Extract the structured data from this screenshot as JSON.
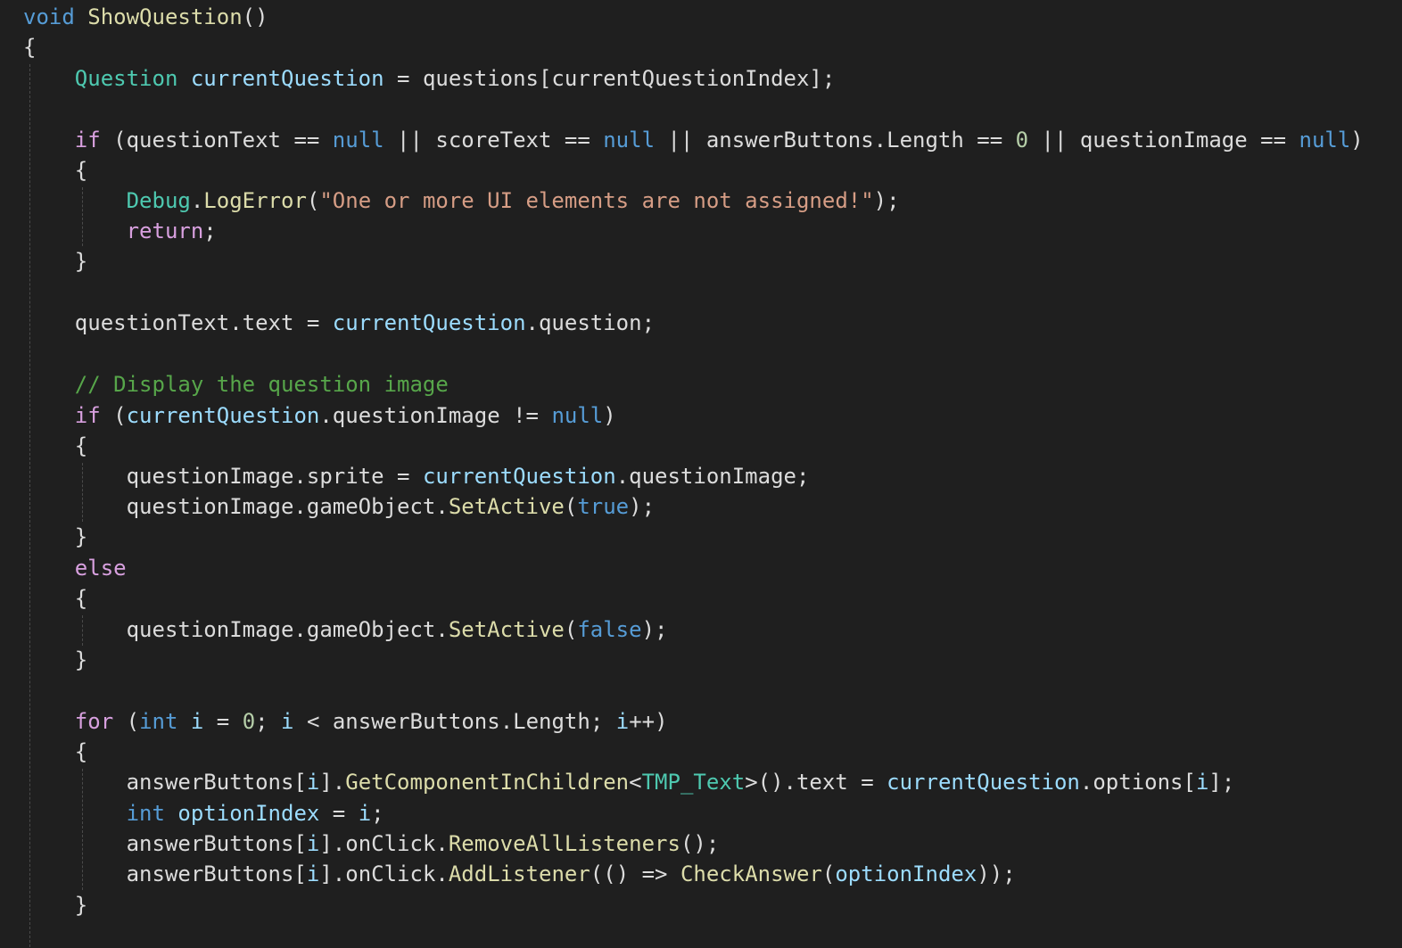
{
  "editor": {
    "language": "C#",
    "theme_colors": {
      "background": "#1f1f1f",
      "default": "#dcdcdc",
      "keyword": "#569cd6",
      "control": "#d8a0df",
      "type": "#4ec9b0",
      "method": "#dcdcaa",
      "local": "#9cdcfe",
      "string": "#d69d85",
      "number": "#b5cea8",
      "comment": "#57a64a",
      "guide": "#4a4a4a"
    },
    "lines": [
      [
        [
          "kw",
          "void"
        ],
        [
          "txt",
          " "
        ],
        [
          "fn",
          "ShowQuestion"
        ],
        [
          "txt",
          "()"
        ]
      ],
      [
        [
          "txt",
          "{"
        ]
      ],
      [
        [
          "txt",
          "    "
        ],
        [
          "type",
          "Question"
        ],
        [
          "txt",
          " "
        ],
        [
          "var",
          "currentQuestion"
        ],
        [
          "txt",
          " = questions[currentQuestionIndex];"
        ]
      ],
      [],
      [
        [
          "txt",
          "    "
        ],
        [
          "ctl",
          "if"
        ],
        [
          "txt",
          " (questionText == "
        ],
        [
          "kw",
          "null"
        ],
        [
          "txt",
          " || scoreText == "
        ],
        [
          "kw",
          "null"
        ],
        [
          "txt",
          " || answerButtons.Length == "
        ],
        [
          "num",
          "0"
        ],
        [
          "txt",
          " || questionImage == "
        ],
        [
          "kw",
          "null"
        ],
        [
          "txt",
          ")"
        ]
      ],
      [
        [
          "txt",
          "    {"
        ]
      ],
      [
        [
          "txt",
          "        "
        ],
        [
          "type",
          "Debug"
        ],
        [
          "txt",
          "."
        ],
        [
          "fn",
          "LogError"
        ],
        [
          "txt",
          "("
        ],
        [
          "str",
          "\"One or more UI elements are not assigned!\""
        ],
        [
          "txt",
          ");"
        ]
      ],
      [
        [
          "txt",
          "        "
        ],
        [
          "ctl",
          "return"
        ],
        [
          "txt",
          ";"
        ]
      ],
      [
        [
          "txt",
          "    }"
        ]
      ],
      [],
      [
        [
          "txt",
          "    questionText.text = "
        ],
        [
          "var",
          "currentQuestion"
        ],
        [
          "txt",
          ".question;"
        ]
      ],
      [],
      [
        [
          "txt",
          "    "
        ],
        [
          "cmt",
          "// Display the question image"
        ]
      ],
      [
        [
          "txt",
          "    "
        ],
        [
          "ctl",
          "if"
        ],
        [
          "txt",
          " ("
        ],
        [
          "var",
          "currentQuestion"
        ],
        [
          "txt",
          ".questionImage != "
        ],
        [
          "kw",
          "null"
        ],
        [
          "txt",
          ")"
        ]
      ],
      [
        [
          "txt",
          "    {"
        ]
      ],
      [
        [
          "txt",
          "        questionImage.sprite = "
        ],
        [
          "var",
          "currentQuestion"
        ],
        [
          "txt",
          ".questionImage;"
        ]
      ],
      [
        [
          "txt",
          "        questionImage.gameObject."
        ],
        [
          "fn",
          "SetActive"
        ],
        [
          "txt",
          "("
        ],
        [
          "kw",
          "true"
        ],
        [
          "txt",
          ");"
        ]
      ],
      [
        [
          "txt",
          "    }"
        ]
      ],
      [
        [
          "txt",
          "    "
        ],
        [
          "ctl",
          "else"
        ]
      ],
      [
        [
          "txt",
          "    {"
        ]
      ],
      [
        [
          "txt",
          "        questionImage.gameObject."
        ],
        [
          "fn",
          "SetActive"
        ],
        [
          "txt",
          "("
        ],
        [
          "kw",
          "false"
        ],
        [
          "txt",
          ");"
        ]
      ],
      [
        [
          "txt",
          "    }"
        ]
      ],
      [],
      [
        [
          "txt",
          "    "
        ],
        [
          "ctl",
          "for"
        ],
        [
          "txt",
          " ("
        ],
        [
          "kw",
          "int"
        ],
        [
          "txt",
          " "
        ],
        [
          "var",
          "i"
        ],
        [
          "txt",
          " = "
        ],
        [
          "num",
          "0"
        ],
        [
          "txt",
          "; "
        ],
        [
          "var",
          "i"
        ],
        [
          "txt",
          " < answerButtons.Length; "
        ],
        [
          "var",
          "i"
        ],
        [
          "txt",
          "++)"
        ]
      ],
      [
        [
          "txt",
          "    {"
        ]
      ],
      [
        [
          "txt",
          "        answerButtons["
        ],
        [
          "var",
          "i"
        ],
        [
          "txt",
          "]."
        ],
        [
          "fn",
          "GetComponentInChildren"
        ],
        [
          "txt",
          "<"
        ],
        [
          "type",
          "TMP_Text"
        ],
        [
          "txt",
          ">().text = "
        ],
        [
          "var",
          "currentQuestion"
        ],
        [
          "txt",
          ".options["
        ],
        [
          "var",
          "i"
        ],
        [
          "txt",
          "];"
        ]
      ],
      [
        [
          "txt",
          "        "
        ],
        [
          "kw",
          "int"
        ],
        [
          "txt",
          " "
        ],
        [
          "var",
          "optionIndex"
        ],
        [
          "txt",
          " = "
        ],
        [
          "var",
          "i"
        ],
        [
          "txt",
          ";"
        ]
      ],
      [
        [
          "txt",
          "        answerButtons["
        ],
        [
          "var",
          "i"
        ],
        [
          "txt",
          "].onClick."
        ],
        [
          "fn",
          "RemoveAllListeners"
        ],
        [
          "txt",
          "();"
        ]
      ],
      [
        [
          "txt",
          "        answerButtons["
        ],
        [
          "var",
          "i"
        ],
        [
          "txt",
          "].onClick."
        ],
        [
          "fn",
          "AddListener"
        ],
        [
          "txt",
          "(() => "
        ],
        [
          "fn",
          "CheckAnswer"
        ],
        [
          "txt",
          "("
        ],
        [
          "var",
          "optionIndex"
        ],
        [
          "txt",
          "));"
        ]
      ],
      [
        [
          "txt",
          "    }"
        ]
      ]
    ]
  }
}
